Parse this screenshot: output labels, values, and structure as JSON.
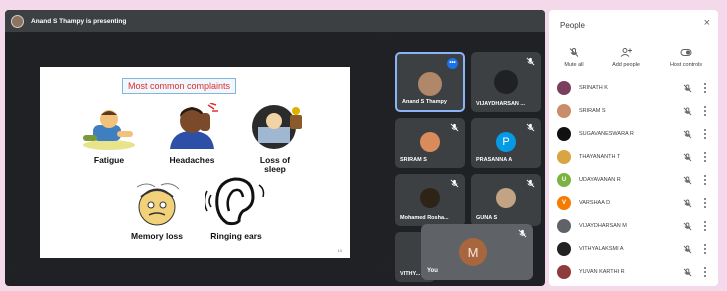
{
  "presenting": {
    "text": "Anand S Thampy is presenting"
  },
  "slide": {
    "title": "Most common complaints",
    "items": [
      {
        "label": "Fatigue",
        "icon": "fatigue-icon"
      },
      {
        "label": "Headaches",
        "icon": "headache-icon"
      },
      {
        "label": "Loss of sleep",
        "icon": "sleepless-icon"
      },
      {
        "label": "Memory loss",
        "icon": "memory-loss-icon"
      },
      {
        "label": "Ringing ears",
        "icon": "ear-icon"
      }
    ],
    "page_number": "10"
  },
  "tiles": [
    {
      "name": "Anand S Thampy",
      "active": true
    },
    {
      "name": "VIJAYDHARSAN ..."
    },
    {
      "name": "SRIRAM S"
    },
    {
      "name": "PRASANNA A",
      "initial": "P"
    },
    {
      "name": "Mohamed Rosha..."
    },
    {
      "name": "GUNA S"
    },
    {
      "name": "VITHY..."
    }
  ],
  "self_view": {
    "label": "You",
    "initial": "M"
  },
  "people_panel": {
    "title": "People",
    "close_icon": "×",
    "actions": [
      {
        "label": "Mute all",
        "icon": "mic-off-icon"
      },
      {
        "label": "Add people",
        "icon": "add-person-icon"
      },
      {
        "label": "Host controls",
        "icon": "toggle-icon"
      }
    ],
    "participants": [
      {
        "name": "SRINATH K",
        "color": "#7b3f5e"
      },
      {
        "name": "SRIRAM S",
        "color": "#c98d6b"
      },
      {
        "name": "SUGAVANESWARA R",
        "color": "#111111"
      },
      {
        "name": "THAYANANTH T",
        "color": "#d9a441"
      },
      {
        "name": "UDAYAVANAN R",
        "color": "#7cb342",
        "initial": "U"
      },
      {
        "name": "VARSHAA D",
        "color": "#f57c00",
        "initial": "V"
      },
      {
        "name": "VIJAYDHARSAN M",
        "color": "#5f6368"
      },
      {
        "name": "VITHYALAKSMI A",
        "color": "#222222"
      },
      {
        "name": "YUVAN KARTHI R",
        "color": "#8d3b3b"
      }
    ]
  }
}
